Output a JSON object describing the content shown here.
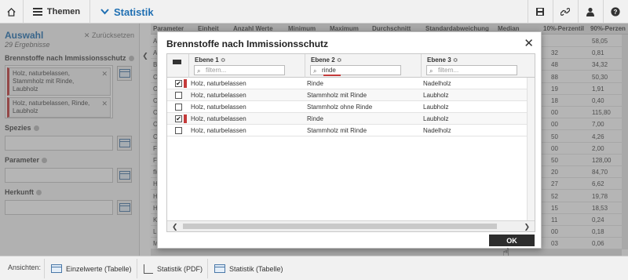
{
  "topbar": {
    "themen": "Themen",
    "statistik": "Statistik"
  },
  "left": {
    "title": "Auswahl",
    "count": "29 Ergebnisse",
    "reset": "Zurücksetzen",
    "filters": [
      {
        "label": "Brennstoffe nach Immissionsschutz",
        "chips": [
          "Holz, naturbelassen, Stammholz mit Rinde, Laubholz",
          "Holz, naturbelassen, Rinde, Laubholz"
        ]
      },
      {
        "label": "Spezies"
      },
      {
        "label": "Parameter"
      },
      {
        "label": "Herkunft"
      }
    ]
  },
  "background_table": {
    "headers": [
      "Parameter",
      "Einheit",
      "Anzahl Werte",
      "Minimum",
      "Maximum",
      "Durchschnitt",
      "Standardabweichung",
      "Median",
      "10%-Perzentil",
      "90%-Perzen"
    ],
    "rows": [
      {
        "p": "Al",
        "p10": "",
        "p90": "58,05"
      },
      {
        "p": "As",
        "p10": "32",
        "p90": "0,81"
      },
      {
        "p": "B",
        "p10": "48",
        "p90": "34,32"
      },
      {
        "p": "C",
        "p10": "88",
        "p90": "50,30"
      },
      {
        "p": "Ca",
        "p10": "19",
        "p90": "1,91"
      },
      {
        "p": "Cd",
        "p10": "18",
        "p90": "0,40"
      },
      {
        "p": "Cl",
        "p10": "00",
        "p90": "115,80"
      },
      {
        "p": "Co",
        "p10": "00",
        "p90": "7,00"
      },
      {
        "p": "Cu",
        "p10": "50",
        "p90": "4,26"
      },
      {
        "p": "F",
        "p10": "00",
        "p90": "2,00"
      },
      {
        "p": "Fe",
        "p10": "50",
        "p90": "128,00"
      },
      {
        "p": "flü",
        "p10": "20",
        "p90": "84,70"
      },
      {
        "p": "H",
        "p10": "27",
        "p90": "6,62"
      },
      {
        "p": "He",
        "p10": "52",
        "p90": "19,78"
      },
      {
        "p": "He",
        "p10": "15",
        "p90": "18,53"
      },
      {
        "p": "K",
        "p10": "11",
        "p90": "0,24"
      },
      {
        "p": "Lin",
        "p10": "00",
        "p90": "0,18"
      },
      {
        "p": "Mo",
        "p10": "03",
        "p90": "0,06"
      }
    ]
  },
  "dialog": {
    "title": "Brennstoffe nach Immissionsschutz",
    "columns": [
      {
        "title": "Ebene 1",
        "filter_value": "",
        "placeholder": "filtern..."
      },
      {
        "title": "Ebene 2",
        "filter_value": "rinde",
        "placeholder": "filtern..."
      },
      {
        "title": "Ebene 3",
        "filter_value": "",
        "placeholder": "filtern..."
      }
    ],
    "rows": [
      {
        "checked": true,
        "ebene1": "Holz, naturbelassen",
        "ebene2": "Rinde",
        "ebene3": "Nadelholz"
      },
      {
        "checked": false,
        "ebene1": "Holz, naturbelassen",
        "ebene2": "Stammholz mit Rinde",
        "ebene3": "Laubholz"
      },
      {
        "checked": false,
        "ebene1": "Holz, naturbelassen",
        "ebene2": "Stammholz ohne Rinde",
        "ebene3": "Laubholz"
      },
      {
        "checked": true,
        "ebene1": "Holz, naturbelassen",
        "ebene2": "Rinde",
        "ebene3": "Laubholz"
      },
      {
        "checked": false,
        "ebene1": "Holz, naturbelassen",
        "ebene2": "Stammholz mit Rinde",
        "ebene3": "Nadelholz"
      }
    ],
    "ok_label": "OK",
    "accent_color": "#c43a3a"
  },
  "bottombar": {
    "label": "Ansichten:",
    "views": [
      "Einzelwerte (Tabelle)",
      "Statistik (PDF)",
      "Statistik (Tabelle)"
    ]
  }
}
